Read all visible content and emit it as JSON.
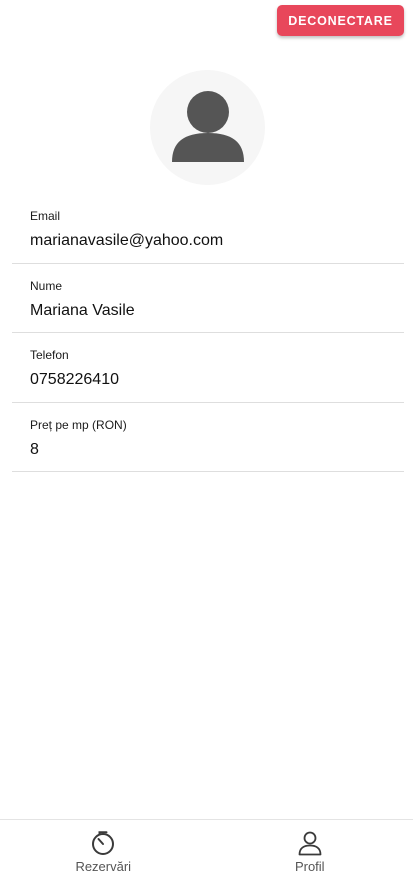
{
  "header": {
    "logout_label": "DECONECTARE"
  },
  "avatar": {
    "icon": "person-icon"
  },
  "profile": {
    "fields": [
      {
        "label": "Email",
        "value": "marianavasile@yahoo.com"
      },
      {
        "label": "Nume",
        "value": "Mariana Vasile"
      },
      {
        "label": "Telefon",
        "value": "0758226410"
      },
      {
        "label": "Preț pe mp (RON)",
        "value": "8"
      }
    ]
  },
  "bottom_nav": {
    "items": [
      {
        "label": "Rezervări",
        "icon": "timer-icon"
      },
      {
        "label": "Profil",
        "icon": "person-outline-icon"
      }
    ]
  },
  "colors": {
    "accent": "#e8475b",
    "avatar_bg": "#f6f6f6",
    "avatar_icon": "#555555"
  }
}
